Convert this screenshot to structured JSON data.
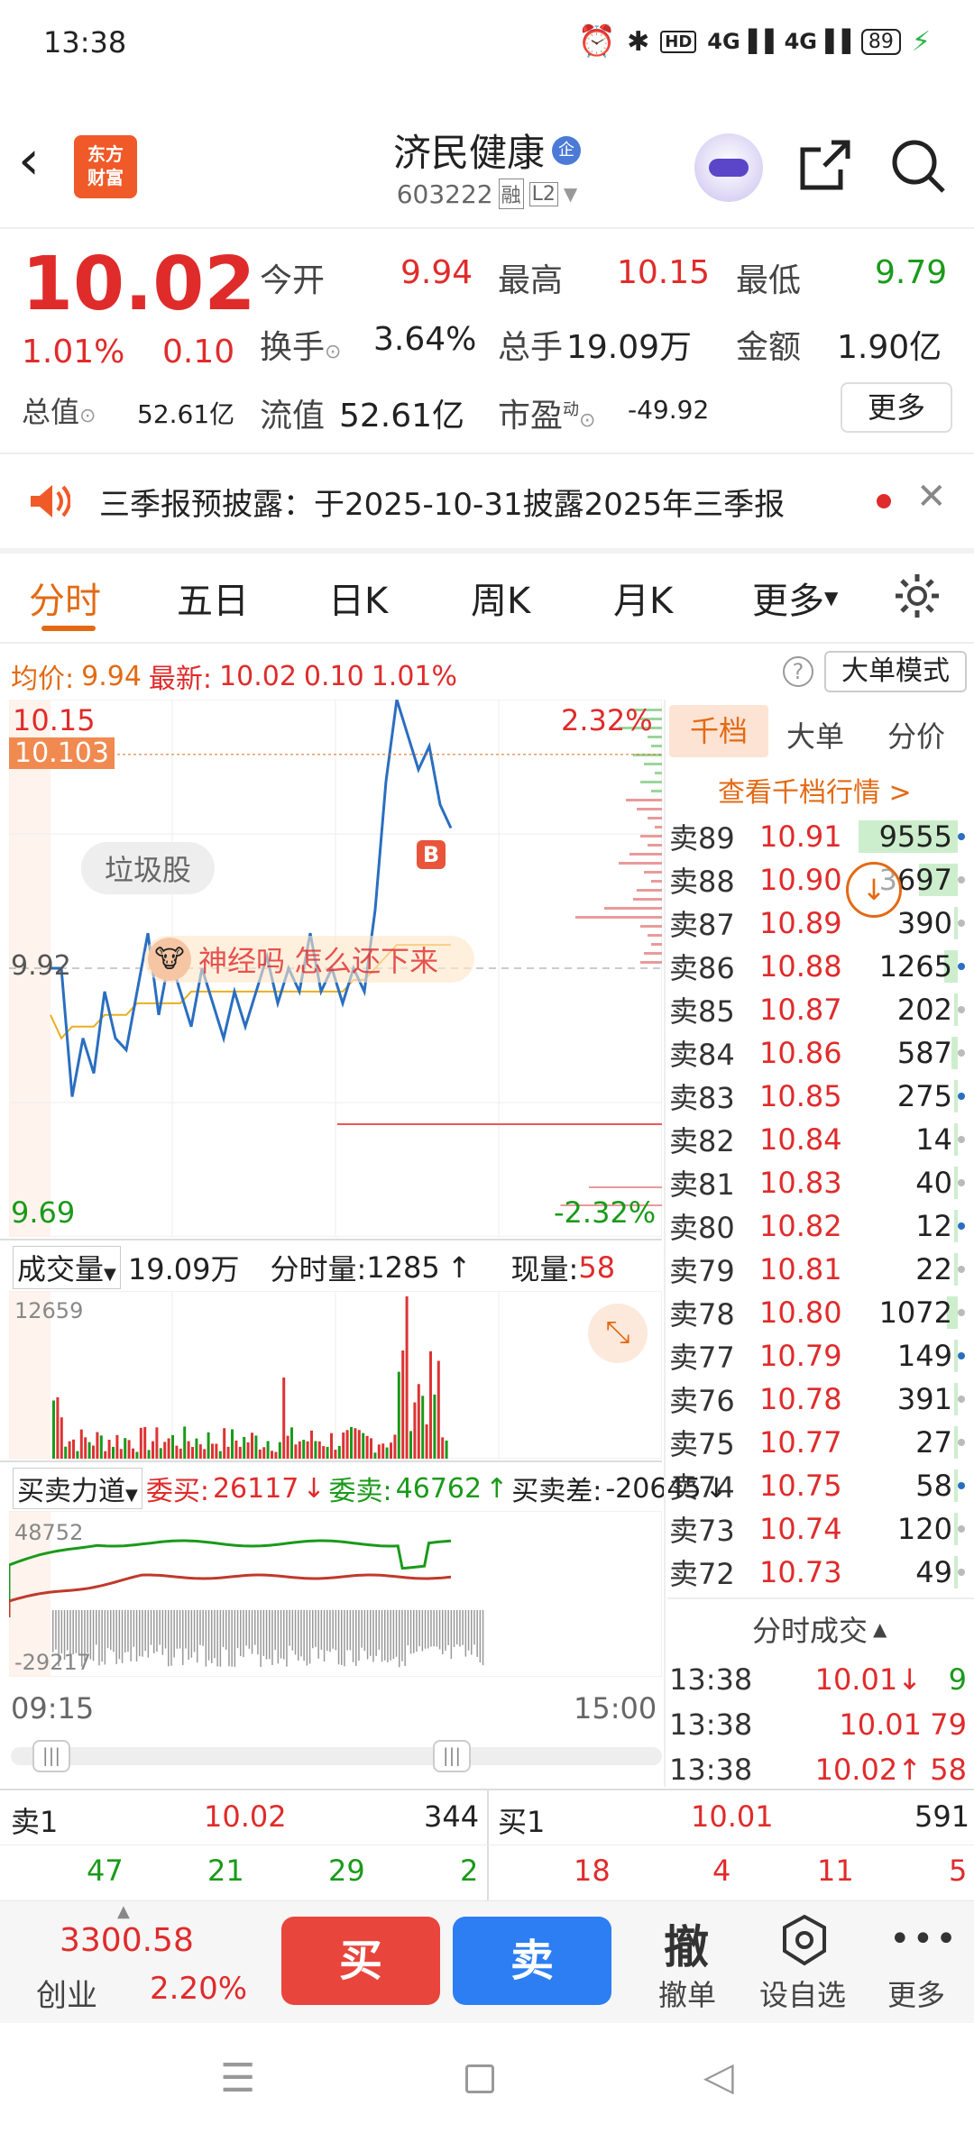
{
  "status_bar": {
    "time": "13:38",
    "battery": "89"
  },
  "header": {
    "logo_line1": "东方",
    "logo_line2": "财富",
    "title": "济民健康",
    "badge": "企",
    "code": "603222",
    "tag1": "融",
    "tag2": "L2"
  },
  "quote": {
    "price": "10.02",
    "pct": "1.01%",
    "change": "0.10",
    "open_label": "今开",
    "open": "9.94",
    "high_label": "最高",
    "high": "10.15",
    "low_label": "最低",
    "low": "9.79",
    "turnover_label": "换手",
    "turnover": "3.64%",
    "volume_label": "总手",
    "volume": "19.09万",
    "amount_label": "金额",
    "amount": "1.90亿",
    "mktcap_label": "总值",
    "mktcap": "52.61亿",
    "float_label": "流值",
    "float": "52.61亿",
    "pe_label": "市盈",
    "pe_sup": "动",
    "pe": "-49.92",
    "more": "更多"
  },
  "notice": {
    "text": "三季报预披露：于2025-10-31披露2025年三季报"
  },
  "tabs": [
    "分时",
    "五日",
    "日K",
    "周K",
    "月K",
    "更多"
  ],
  "info_line": {
    "avg_label": "均价:",
    "avg": "9.94",
    "latest_label": "最新:",
    "latest": "10.02",
    "chg": "0.10",
    "pct": "1.01%",
    "mode": "大单模式"
  },
  "chart": {
    "top_price": "10.15",
    "top_pct": "2.32%",
    "bottom_price": "9.69",
    "bottom_pct": "-2.32%",
    "mid_price": "9.92",
    "cursor_price": "10.103",
    "marker": "B",
    "bubble": "垃圾股",
    "comment": "神经吗  怎么还下来"
  },
  "chart_data": {
    "type": "line",
    "x": [
      "09:15",
      "15:00"
    ],
    "ylim": [
      9.69,
      10.15
    ],
    "series": [
      {
        "name": "price",
        "values": [
          9.92,
          9.92,
          9.81,
          9.86,
          9.83,
          9.9,
          9.86,
          9.85,
          9.9,
          9.95,
          9.88,
          9.93,
          9.9,
          9.87,
          9.92,
          9.89,
          9.86,
          9.9,
          9.87,
          9.9,
          9.93,
          9.89,
          9.92,
          9.9,
          9.95,
          9.9,
          9.92,
          9.89,
          9.92,
          9.9,
          9.97,
          10.08,
          10.15,
          10.12,
          10.09,
          10.11,
          10.06,
          10.04
        ]
      },
      {
        "name": "avg",
        "values": [
          9.88,
          9.86,
          9.87,
          9.87,
          9.87,
          9.88,
          9.88,
          9.88,
          9.89,
          9.89,
          9.89,
          9.89,
          9.89,
          9.9,
          9.9,
          9.9,
          9.9,
          9.9,
          9.9,
          9.9,
          9.9,
          9.9,
          9.9,
          9.9,
          9.9,
          9.9,
          9.9,
          9.9,
          9.91,
          9.91,
          9.92,
          9.93,
          9.94,
          9.94,
          9.94,
          9.94,
          9.94,
          9.94
        ]
      }
    ]
  },
  "volume": {
    "label": "成交量",
    "total": "19.09万",
    "minute_label": "分时量:",
    "minute": "1285",
    "now_label": "现量:",
    "now": "58",
    "max": "12659"
  },
  "force": {
    "label": "买卖力道",
    "buy_label": "委买:",
    "buy": "26117",
    "sell_label": "委卖:",
    "sell": "46762",
    "diff_label": "买卖差:",
    "diff": "-20645",
    "max": "48752",
    "min": "-29217"
  },
  "time_axis": {
    "start": "09:15",
    "end": "15:00"
  },
  "side": {
    "tabs": [
      "千档",
      "大单",
      "分价"
    ],
    "link": "查看千档行情 >",
    "asks": [
      [
        "卖89",
        "10.91",
        "9555"
      ],
      [
        "卖88",
        "10.90",
        "3697"
      ],
      [
        "卖87",
        "10.89",
        "390"
      ],
      [
        "卖86",
        "10.88",
        "1265"
      ],
      [
        "卖85",
        "10.87",
        "202"
      ],
      [
        "卖84",
        "10.86",
        "587"
      ],
      [
        "卖83",
        "10.85",
        "275"
      ],
      [
        "卖82",
        "10.84",
        "14"
      ],
      [
        "卖81",
        "10.83",
        "40"
      ],
      [
        "卖80",
        "10.82",
        "12"
      ],
      [
        "卖79",
        "10.81",
        "22"
      ],
      [
        "卖78",
        "10.80",
        "1072"
      ],
      [
        "卖77",
        "10.79",
        "149"
      ],
      [
        "卖76",
        "10.78",
        "391"
      ],
      [
        "卖75",
        "10.77",
        "27"
      ],
      [
        "卖74",
        "10.75",
        "58"
      ],
      [
        "卖73",
        "10.74",
        "120"
      ],
      [
        "卖72",
        "10.73",
        "49"
      ]
    ],
    "trades_title": "分时成交",
    "trades": [
      [
        "13:38",
        "10.01↓",
        "9"
      ],
      [
        "13:38",
        "10.01",
        "79"
      ],
      [
        "13:38",
        "10.02↑",
        "58"
      ]
    ]
  },
  "level1": {
    "sell_label": "卖1",
    "sell_price": "10.02",
    "sell_vol": "344",
    "buy_label": "买1",
    "buy_price": "10.01",
    "buy_vol": "591",
    "sell_detail": [
      "47",
      "21",
      "29",
      "2"
    ],
    "buy_detail": [
      "18",
      "4",
      "11",
      "5"
    ]
  },
  "bottom": {
    "index": "3300.58",
    "index_name": "创业",
    "index_pct": "2.20%",
    "buy": "买",
    "sell": "卖",
    "cancel_icon": "撤",
    "cancel": "撤单",
    "watch": "设自选",
    "more": "更多"
  }
}
